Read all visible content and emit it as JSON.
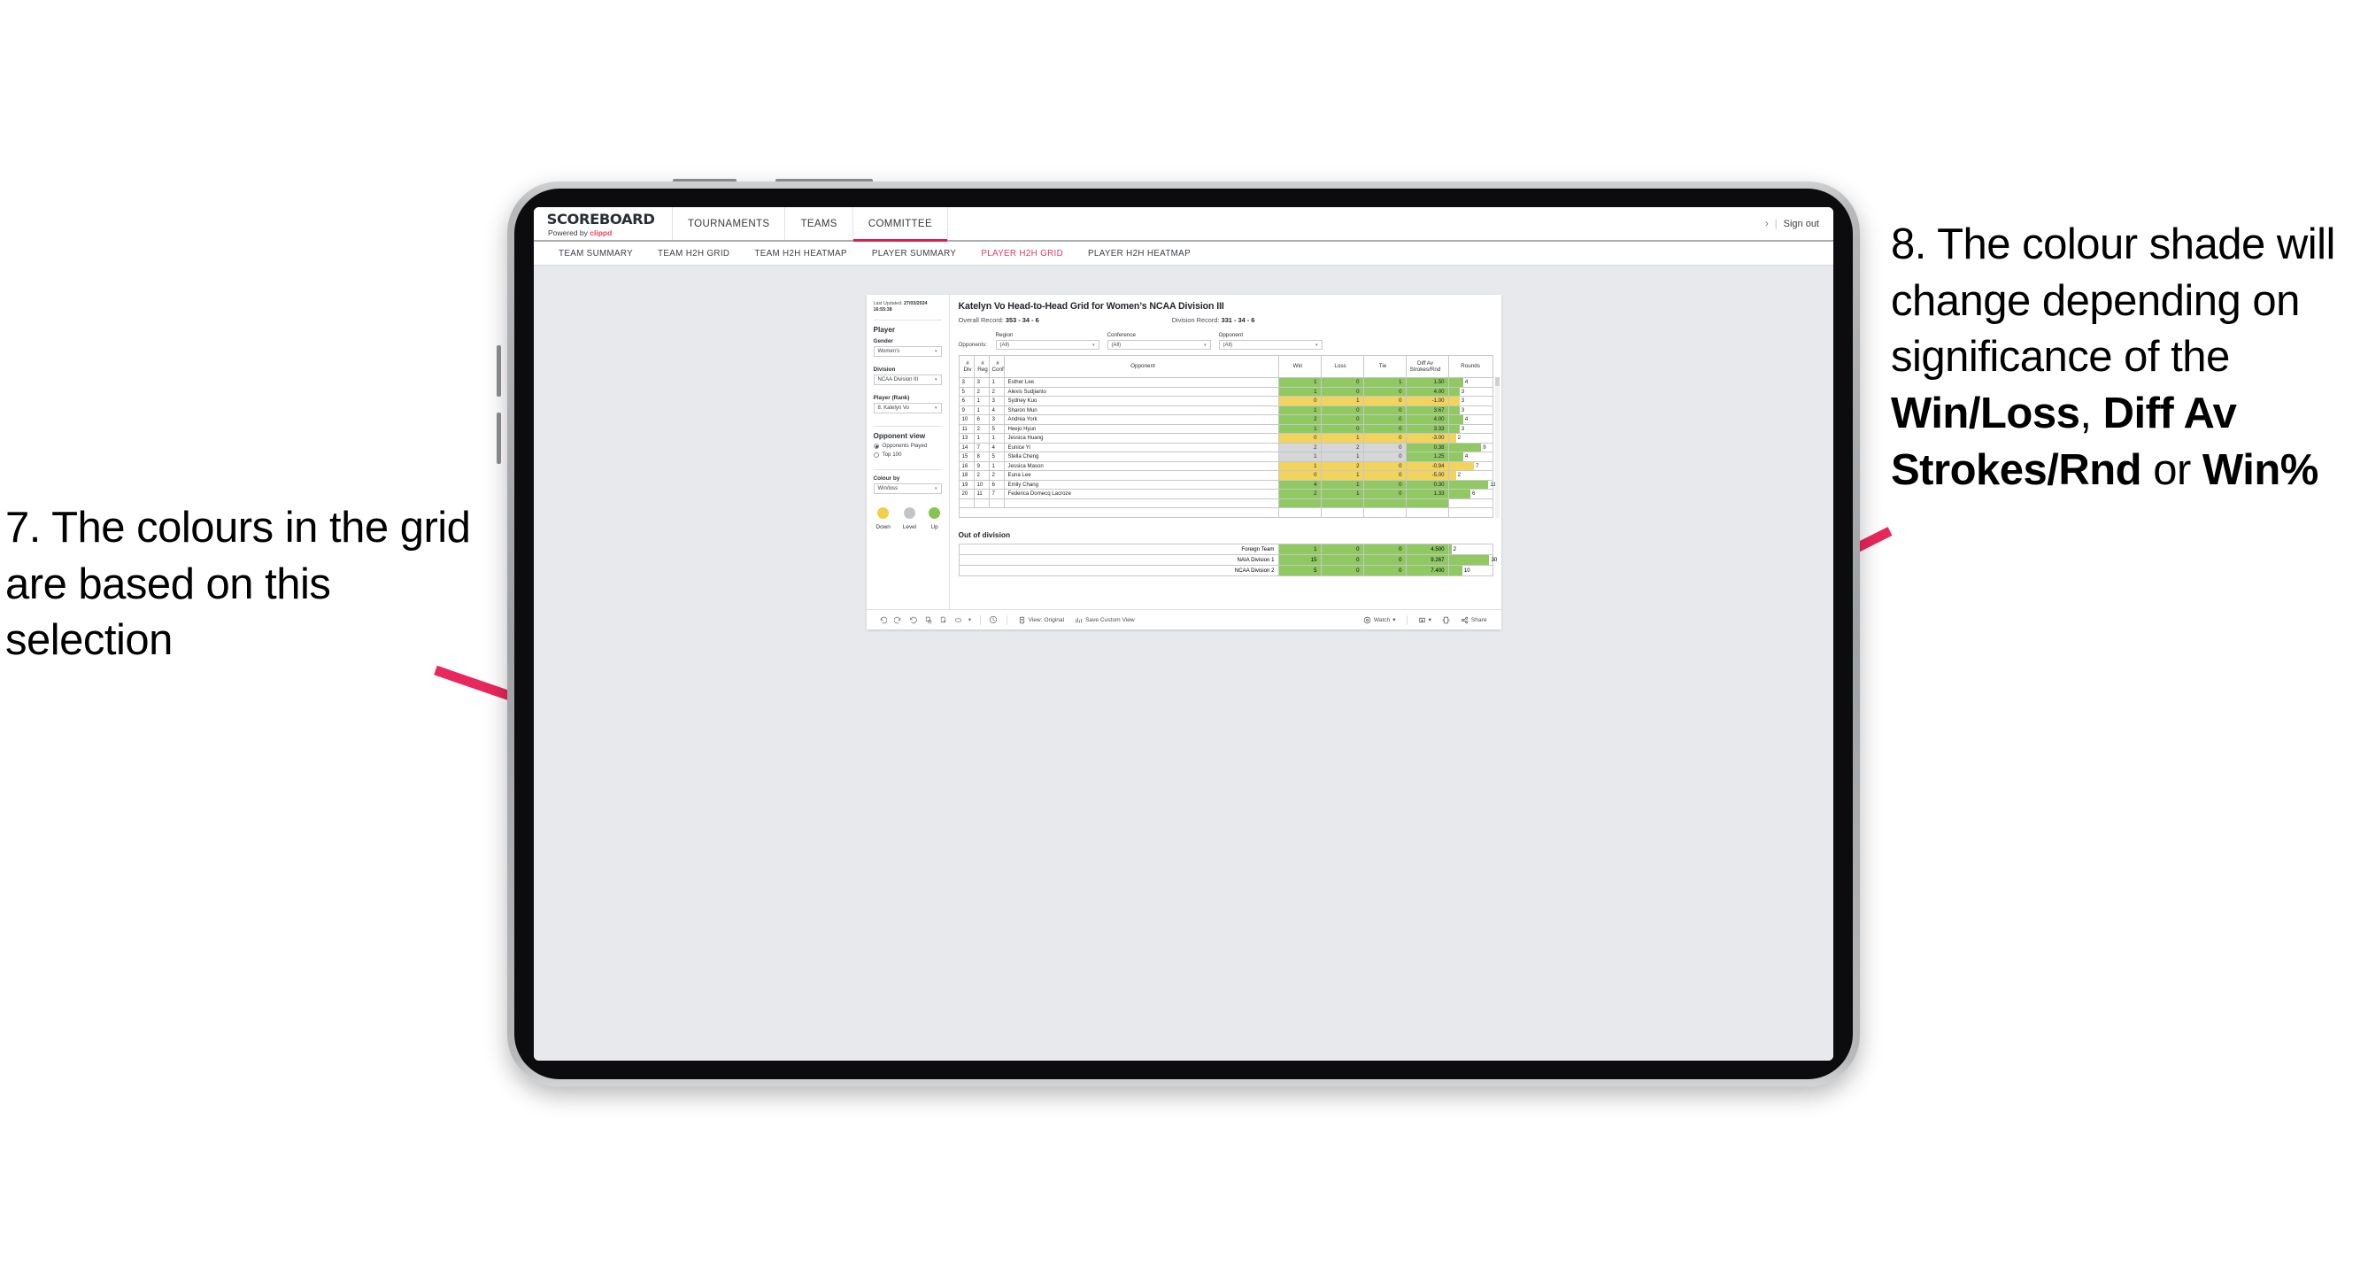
{
  "annotations": {
    "left": {
      "id": "7",
      "text": "7. The colours in the grid are based on this selection"
    },
    "right": {
      "id": "8",
      "line1": "8. The colour shade will change depending on significance of the ",
      "bold1": "Win/Loss",
      "mid1": ", ",
      "bold2": "Diff Av Strokes/Rnd",
      "mid2": " or ",
      "bold3": "Win%"
    },
    "arrow_color": "#e8275c"
  },
  "app": {
    "logo": {
      "title": "SCOREBOARD",
      "powered_prefix": "Powered by ",
      "brand": "clippd"
    },
    "topnav": [
      {
        "label": "TOURNAMENTS",
        "active": false
      },
      {
        "label": "TEAMS",
        "active": false
      },
      {
        "label": "COMMITTEE",
        "active": true
      }
    ],
    "topbar_right": {
      "chevron": "›",
      "separator": "|",
      "sign_out": "Sign out"
    },
    "subnav": [
      {
        "label": "TEAM SUMMARY",
        "active": false
      },
      {
        "label": "TEAM H2H GRID",
        "active": false
      },
      {
        "label": "TEAM H2H HEATMAP",
        "active": false
      },
      {
        "label": "PLAYER SUMMARY",
        "active": false
      },
      {
        "label": "PLAYER H2H GRID",
        "active": true
      },
      {
        "label": "PLAYER H2H HEATMAP",
        "active": false
      }
    ]
  },
  "filters": {
    "last_updated_label": "Last Updated: ",
    "last_updated_value": "27/03/2024 16:55:38",
    "player_heading": "Player",
    "gender": {
      "label": "Gender",
      "value": "Women’s"
    },
    "division": {
      "label": "Division",
      "value": "NCAA Division III"
    },
    "player_rank": {
      "label": "Player (Rank)",
      "value": "8. Katelyn Vo"
    },
    "opponent_view": {
      "heading": "Opponent view",
      "options": [
        {
          "label": "Opponents Played",
          "selected": true
        },
        {
          "label": "Top 100",
          "selected": false
        }
      ]
    },
    "colour_by": {
      "label": "Colour by",
      "value": "Win/loss"
    },
    "legend": [
      {
        "label": "Down",
        "color": "#f2cf48"
      },
      {
        "label": "Level",
        "color": "#c3c6c9"
      },
      {
        "label": "Up",
        "color": "#85c44f"
      }
    ]
  },
  "viz": {
    "title": "Katelyn Vo Head-to-Head Grid for Women’s NCAA Division III",
    "overall_record_label": "Overall Record: ",
    "overall_record_value": "353 -  34 - 6",
    "division_record_label": "Division Record: ",
    "division_record_value": "331 -  34 - 6",
    "opponents_label": "Opponents:",
    "opponent_filters": [
      {
        "label": "Region",
        "value": "(All)"
      },
      {
        "label": "Conference",
        "value": "(All)"
      },
      {
        "label": "Opponent",
        "value": "(All)"
      }
    ],
    "out_of_division_title": "Out of division"
  },
  "chart_data": {
    "type": "table",
    "title": "Katelyn Vo Head-to-Head Grid for Women’s NCAA Division III",
    "columns": [
      "# Div",
      "# Reg",
      "# Conf",
      "Opponent",
      "Win",
      "Loss",
      "Tie",
      "Diff Av Strokes/Rnd",
      "Rounds"
    ],
    "column_headers_multiline": [
      {
        "l1": "#",
        "l2": "Div"
      },
      {
        "l1": "#",
        "l2": "Reg"
      },
      {
        "l1": "#",
        "l2": "Conf"
      },
      {
        "l1": "Opponent",
        "l2": ""
      },
      {
        "l1": "Win",
        "l2": ""
      },
      {
        "l1": "Loss",
        "l2": ""
      },
      {
        "l1": "Tie",
        "l2": ""
      },
      {
        "l1": "Diff Av",
        "l2": "Strokes/Rnd"
      },
      {
        "l1": "Rounds",
        "l2": ""
      }
    ],
    "colors": {
      "up": "#90c961",
      "down": "#f2d35c",
      "level": "#d5d6d8"
    },
    "rounds_max": 12,
    "rows": [
      {
        "div": "3",
        "reg": "3",
        "conf": "1",
        "opponent": "Esther Lee",
        "win": "1",
        "loss": "0",
        "tie": "1",
        "diff": "1.50",
        "rounds": "4",
        "rounds_val": 4,
        "shade": "up"
      },
      {
        "div": "5",
        "reg": "2",
        "conf": "2",
        "opponent": "Alexis Sudjianto",
        "win": "1",
        "loss": "0",
        "tie": "0",
        "diff": "4.00",
        "rounds": "3",
        "rounds_val": 3,
        "shade": "up"
      },
      {
        "div": "6",
        "reg": "1",
        "conf": "3",
        "opponent": "Sydney Kuo",
        "win": "0",
        "loss": "1",
        "tie": "0",
        "diff": "-1.00",
        "rounds": "3",
        "rounds_val": 3,
        "shade": "down"
      },
      {
        "div": "9",
        "reg": "1",
        "conf": "4",
        "opponent": "Sharon Mun",
        "win": "1",
        "loss": "0",
        "tie": "0",
        "diff": "3.67",
        "rounds": "3",
        "rounds_val": 3,
        "shade": "up"
      },
      {
        "div": "10",
        "reg": "6",
        "conf": "3",
        "opponent": "Andrea York",
        "win": "2",
        "loss": "0",
        "tie": "0",
        "diff": "4.00",
        "rounds": "4",
        "rounds_val": 4,
        "shade": "up"
      },
      {
        "div": "11",
        "reg": "2",
        "conf": "5",
        "opponent": "Heejo Hyun",
        "win": "1",
        "loss": "0",
        "tie": "0",
        "diff": "3.33",
        "rounds": "3",
        "rounds_val": 3,
        "shade": "up"
      },
      {
        "div": "13",
        "reg": "1",
        "conf": "1",
        "opponent": "Jessica Huang",
        "win": "0",
        "loss": "1",
        "tie": "0",
        "diff": "-3.00",
        "rounds": "2",
        "rounds_val": 2,
        "shade": "down"
      },
      {
        "div": "14",
        "reg": "7",
        "conf": "4",
        "opponent": "Eunice Yi",
        "win": "2",
        "loss": "2",
        "tie": "0",
        "diff": "0.38",
        "rounds": "9",
        "rounds_val": 9,
        "shade": "level",
        "diff_shade": "up"
      },
      {
        "div": "15",
        "reg": "8",
        "conf": "5",
        "opponent": "Stella Cheng",
        "win": "1",
        "loss": "1",
        "tie": "0",
        "diff": "1.25",
        "rounds": "4",
        "rounds_val": 4,
        "shade": "level",
        "diff_shade": "up"
      },
      {
        "div": "16",
        "reg": "9",
        "conf": "1",
        "opponent": "Jessica Mason",
        "win": "1",
        "loss": "2",
        "tie": "0",
        "diff": "-0.94",
        "rounds": "7",
        "rounds_val": 7,
        "shade": "down"
      },
      {
        "div": "18",
        "reg": "2",
        "conf": "2",
        "opponent": "Euna Lee",
        "win": "0",
        "loss": "1",
        "tie": "0",
        "diff": "-5.00",
        "rounds": "2",
        "rounds_val": 2,
        "shade": "down"
      },
      {
        "div": "19",
        "reg": "10",
        "conf": "6",
        "opponent": "Emily Chang",
        "win": "4",
        "loss": "1",
        "tie": "0",
        "diff": "0.30",
        "rounds": "11",
        "rounds_val": 11,
        "shade": "up"
      },
      {
        "div": "20",
        "reg": "11",
        "conf": "7",
        "opponent": "Federica Domecq Lacroze",
        "win": "2",
        "loss": "1",
        "tie": "0",
        "diff": "1.33",
        "rounds": "6",
        "rounds_val": 6,
        "shade": "up"
      }
    ],
    "out_of_division_rows": [
      {
        "name": "Foreign Team",
        "win": "1",
        "loss": "0",
        "tie": "0",
        "diff": "4.500",
        "rounds": "2",
        "rounds_val": 2,
        "shade": "up"
      },
      {
        "name": "NAIA Division 1",
        "win": "15",
        "loss": "0",
        "tie": "0",
        "diff": "9.267",
        "rounds": "30",
        "rounds_val": 30,
        "shade": "up"
      },
      {
        "name": "NCAA Division 2",
        "win": "5",
        "loss": "0",
        "tie": "0",
        "diff": "7.400",
        "rounds": "10",
        "rounds_val": 10,
        "shade": "up"
      }
    ],
    "out_of_division_rounds_max": 32
  },
  "toolbar": {
    "icons": [
      "undo-icon",
      "redo-icon",
      "revert-icon",
      "refresh-icon",
      "pause-icon",
      "rectangle-select-icon",
      "chevron-down-icon",
      "history-icon"
    ],
    "view_original": "View: Original",
    "save_custom_view": "Save Custom View",
    "watch": "Watch",
    "share": "Share"
  }
}
